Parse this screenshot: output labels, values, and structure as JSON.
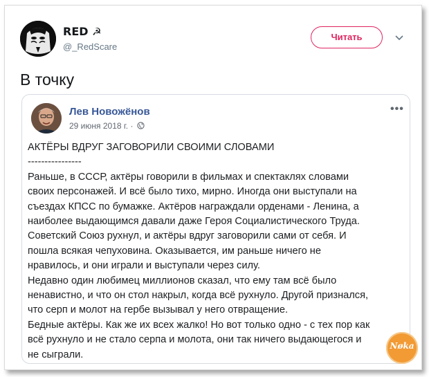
{
  "tweet": {
    "user_name": "RED",
    "user_handle": "@_RedScare",
    "follow_label": "Читать",
    "text": "В точку"
  },
  "quote": {
    "author": "Лев Новожёнов",
    "date": "29 июня 2018 г. ·",
    "body_lines": [
      "АКТЁРЫ ВДРУГ ЗАГОВОРИЛИ СВОИМИ СЛОВАМИ",
      "----------------",
      "Раньше, в СССР, актёры говорили в фильмах и спектаклях словами",
      "своих персонажей. И всё было тихо, мирно. Иногда они выступали на",
      "съездах КПСС по бумажке. Актёров награждали орденами - Ленина, а",
      "наиболее выдающимся давали даже Героя Социалистического Труда.",
      "Советский Союз рухнул, и актёры вдруг заговорили сами от себя. И",
      "пошла всякая чепуховина. Оказывается, им раньше ничего не",
      "нравилось, и они играли и выступали через силу.",
      "Недавно один любимец миллионов сказал, что ему там всё было",
      "ненавистно, и что он стол накрыл, когда всё рухнуло. Другой признался,",
      "что серп и молот на гербе вызывал у него отвращение.",
      "Бедные актёры. Как же их всех жалко! Но вот только одно - с тех пор как",
      "всё рухнуло и не стало серпа и молота, они так ничего выдающегося и",
      "не сыграли."
    ]
  },
  "icons": {
    "sickle": "hammer-sickle-icon",
    "chevron": "chevron-down-icon",
    "globe": "globe-icon",
    "more": "more-dots-icon"
  },
  "colors": {
    "accent": "#e0245e",
    "fb_name": "#385898"
  }
}
